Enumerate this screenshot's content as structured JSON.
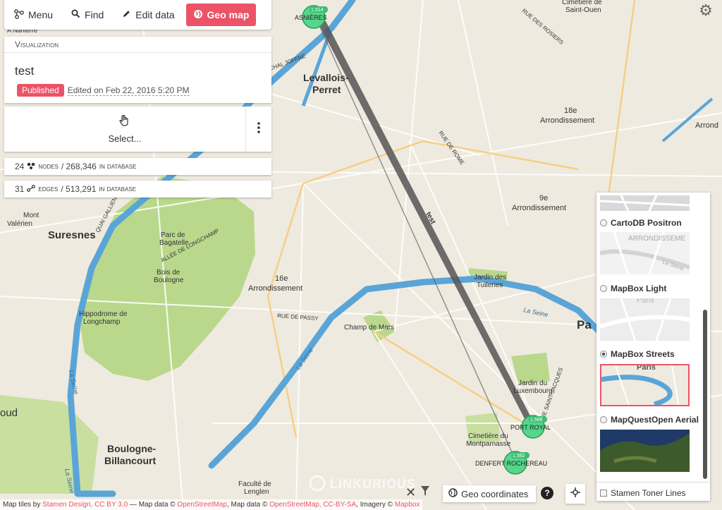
{
  "toolbar": {
    "menu": "Menu",
    "find": "Find",
    "edit_data": "Edit data",
    "geo_map": "Geo map"
  },
  "visualization": {
    "heading": "Visualization",
    "title": "test",
    "status": "Published",
    "edited": "Edited on Feb 22, 2016 5:20 PM"
  },
  "selection": {
    "label": "Select..."
  },
  "stats": {
    "nodes_count": "24",
    "nodes_label": "nodes",
    "nodes_total": "/ 268,346",
    "nodes_suffix": "in database",
    "edges_count": "31",
    "edges_label": "edges",
    "edges_total": "/ 513,291",
    "edges_suffix": "in database"
  },
  "map": {
    "edge_label": "test",
    "nodes": [
      {
        "name": "ASNIÈRES",
        "badge": "1,514"
      },
      {
        "name": "PORT ROYAL",
        "badge": "1,566"
      },
      {
        "name": "DENFERT ROCHEREAU",
        "badge": "1,582"
      }
    ],
    "places": {
      "levallois": "Levallois-",
      "perret": "Perret",
      "suresnes": "Suresnes",
      "boulogne": "Boulogne-",
      "billancourt": "Billancourt",
      "arr18": "18e",
      "arr18b": "Arrondissement",
      "arr9": "9e",
      "arr9b": "Arrondissement",
      "arr16": "16e",
      "arr16b": "Arrondissement",
      "pa": "Pa",
      "mont": "Mont",
      "valerien": "Valérien",
      "bagatelle1": "Parc de",
      "bagatelle2": "Bagatelle",
      "bois1": "Bois de",
      "bois2": "Boulogne",
      "hippo1": "Hippodrome de",
      "hippo2": "Longchamp",
      "champ": "Champ de Mars",
      "jardin1": "Jardin des",
      "jardin2": "Tuileries",
      "lux1": "Jardin du",
      "lux2": "Luxembourg",
      "cim1": "Cimetière du",
      "cim2": "Montparnasse",
      "fac1": "Faculté de",
      "fac2": "Lenglen",
      "oud": "oud",
      "seine1": "La Seine",
      "seine2": "La Seine",
      "seine3": "La Seine",
      "seine4": "La Seine",
      "rue_passy": "RUE DE PASSY",
      "rue_rome": "RUE DE ROME",
      "rue_rosiers": "RUE DES ROSIERS",
      "longchamp": "ALLÉE DE LONGCHAMP",
      "quai": "QUAI GALLIENI",
      "cimetiere_nord1": "Cimetière de",
      "cimetiere_nord2": "Saint-Ouen",
      "nanterre": "A Nanterre",
      "joffre": "CHAL JOFFRE",
      "saint_jacques": "RUE SAINT-JACQUES",
      "arron_edge": "Arrond"
    }
  },
  "layers": {
    "options": [
      {
        "label": "CartoDB Positron",
        "selected": false
      },
      {
        "label": "MapBox Light",
        "selected": false
      },
      {
        "label": "MapBox Streets",
        "selected": true
      },
      {
        "label": "MapQuestOpen Aerial",
        "selected": false
      }
    ],
    "overlay": "Stamen Toner Lines",
    "thumb_labels": {
      "positron": "ARRONDISSEME",
      "positron_seine": "La Seine",
      "light": "Paris",
      "streets": "Paris"
    }
  },
  "bottom": {
    "geo_coordinates": "Geo coordinates",
    "watermark": "LINKURIOUS"
  },
  "attribution": {
    "prefix": "Map tiles by",
    "stamen": "Stamen Design, CC BY 3.0",
    "mid1": "— Map data ©",
    "osm1": "OpenStreetMap",
    "mid2": ", Map data ©",
    "osm2": "OpenStreetMap, CC-BY-SA",
    "mid3": ", Imagery ©",
    "mapbox": "Mapbox"
  },
  "colors": {
    "accent": "#ec5366",
    "node": "#55d68a",
    "water": "#5aa5d8",
    "park": "#b9d88c",
    "edge": "#555555"
  }
}
